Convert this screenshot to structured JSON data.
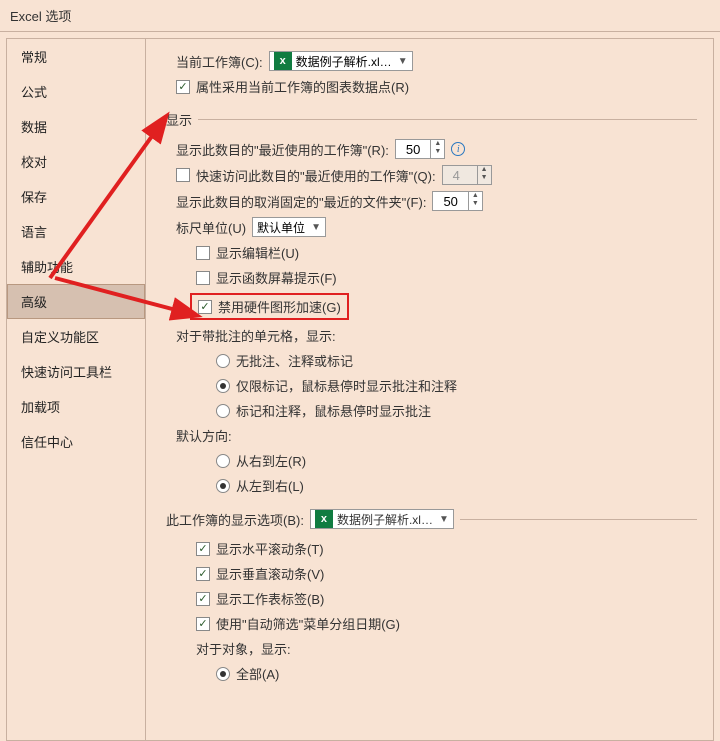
{
  "title": "Excel 选项",
  "sidebar": {
    "items": [
      {
        "label": "常规"
      },
      {
        "label": "公式"
      },
      {
        "label": "数据"
      },
      {
        "label": "校对"
      },
      {
        "label": "保存"
      },
      {
        "label": "语言"
      },
      {
        "label": "辅助功能"
      },
      {
        "label": "高级"
      },
      {
        "label": "自定义功能区"
      },
      {
        "label": "快速访问工具栏"
      },
      {
        "label": "加载项"
      },
      {
        "label": "信任中心"
      }
    ],
    "selected_index": 7
  },
  "top": {
    "current_workbook_label": "当前工作簿(C):",
    "current_workbook_value": "数据例子解析.xl…",
    "props_follow_label": "属性采用当前工作簿的图表数据点(R)"
  },
  "section1": {
    "head": "显示",
    "recent_wb_label": "显示此数目的\"最近使用的工作簿\"(R):",
    "recent_wb_value": "50",
    "quick_access_label": "快速访问此数目的\"最近使用的工作簿\"(Q):",
    "quick_access_value": "4",
    "recent_folders_label": "显示此数目的取消固定的\"最近的文件夹\"(F):",
    "recent_folders_value": "50",
    "ruler_label": "标尺单位(U)",
    "ruler_value": "默认单位",
    "show_formula_bar": "显示编辑栏(U)",
    "show_fn_tips": "显示函数屏幕提示(F)",
    "disable_hw_accel": "禁用硬件图形加速(G)",
    "comments_head": "对于带批注的单元格，显示:",
    "radio1": "无批注、注释或标记",
    "radio2": "仅限标记，鼠标悬停时显示批注和注释",
    "radio3": "标记和注释，鼠标悬停时显示批注",
    "direction_head": "默认方向:",
    "dir_rtl": "从右到左(R)",
    "dir_ltr": "从左到右(L)"
  },
  "section2": {
    "head": "此工作簿的显示选项(B):",
    "wb_value": "数据例子解析.xl…",
    "hscroll": "显示水平滚动条(T)",
    "vscroll": "显示垂直滚动条(V)",
    "tabs": "显示工作表标签(B)",
    "autofilter": "使用\"自动筛选\"菜单分组日期(G)",
    "objects_head": "对于对象，显示:",
    "obj_all": "全部(A)"
  }
}
